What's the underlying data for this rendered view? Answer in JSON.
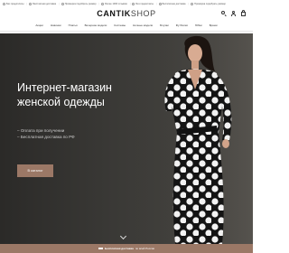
{
  "promo": {
    "items": [
      "Без предоплаты",
      "Бесплатная доставка",
      "Примерка подобрать размер",
      "Более 1000 отзывов",
      "Без предоплаты",
      "Бесплатная доставка",
      "Примерка подобрать размер"
    ]
  },
  "header": {
    "logo_bold": "CANTIK",
    "logo_light": "SHOP"
  },
  "nav": {
    "items": [
      "Акции",
      "Новинки",
      "Платья",
      "Вечерние модели",
      "Костюмы",
      "Ночные модели",
      "Блузки",
      "Футболки",
      "Юбки",
      "Брюки"
    ]
  },
  "hero": {
    "title_line1": "Интернет-магазин",
    "title_line2": "женской одежды",
    "bullets": [
      "Оплата при получении",
      "Бесплатная доставка по РФ"
    ],
    "button_label": "В каталог"
  },
  "footer_bar": {
    "strong": "Бесплатная доставка",
    "text": "по всей России"
  },
  "colors": {
    "accent": "#9b7866",
    "hero_bg": "#3a3936"
  }
}
